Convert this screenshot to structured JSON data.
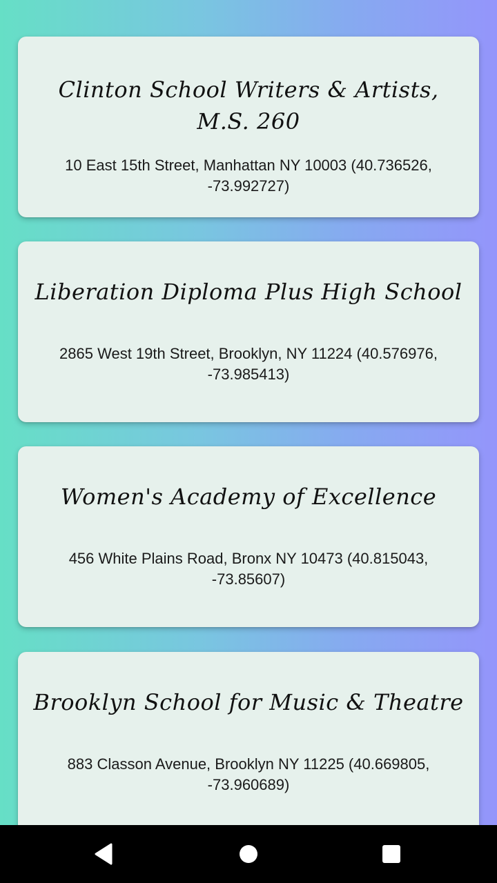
{
  "schools": [
    {
      "name": "Clinton School Writers & Artists, M.S. 260",
      "address": "10 East 15th Street, Manhattan NY 10003 (40.736526, -73.992727)"
    },
    {
      "name": "Liberation Diploma Plus High School",
      "address": "2865 West 19th Street, Brooklyn, NY 11224 (40.576976, -73.985413)"
    },
    {
      "name": "Women's Academy of Excellence",
      "address": "456 White Plains Road, Bronx NY 10473 (40.815043, -73.85607)"
    },
    {
      "name": "Brooklyn School for Music & Theatre",
      "address": "883 Classon Avenue, Brooklyn NY 11225 (40.669805, -73.960689)"
    }
  ],
  "navbar": {
    "back_icon": "back-triangle-icon",
    "home_icon": "home-circle-icon",
    "recents_icon": "recents-square-icon"
  }
}
